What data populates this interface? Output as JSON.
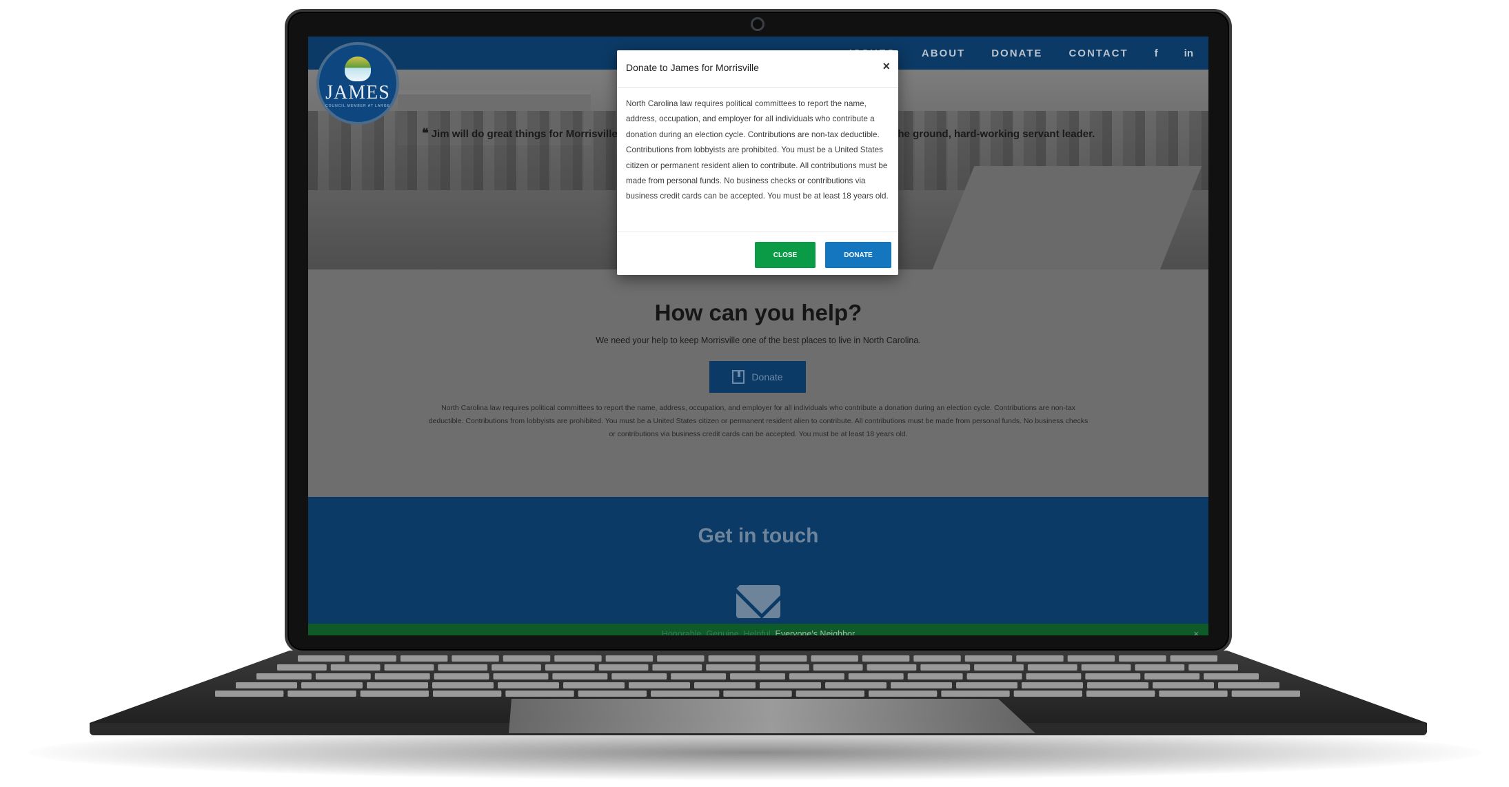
{
  "nav": {
    "links": [
      "ISSUES",
      "ABOUT",
      "DONATE",
      "CONTACT"
    ],
    "social": [
      "f",
      "in"
    ]
  },
  "logo": {
    "name": "JAMES",
    "sub": "COUNCIL MEMBER AT LARGE"
  },
  "hero": {
    "quote_start": "Jim will do great things for Morrisville. H",
    "quote_end": "on the ground, hard-working servant leader."
  },
  "help": {
    "title": "How can you help?",
    "subtitle": "We need your help to keep Morrisville one of the best places to live in North Carolina.",
    "donate_label": "Donate",
    "legal": "North Carolina law requires political committees to report the name, address, occupation, and employer for all individuals who contribute a donation during an election cycle. Contributions are non-tax deductible. Contributions from lobbyists are prohibited. You must be a United States citizen or permanent resident alien to contribute. All contributions must be made from personal funds. No business checks or contributions via business credit cards can be accepted. You must be at least 18 years old."
  },
  "touch": {
    "title": "Get in touch"
  },
  "footer": {
    "text": "Honorable. Genuine. Helpful.",
    "emphasis": "Everyone's Neighbor",
    "close": "×"
  },
  "modal": {
    "title": "Donate to James for Morrisville",
    "close_x": "×",
    "body": "North Carolina law requires political committees to report the name, address, occupation, and employer for all individuals who contribute a donation during an election cycle. Contributions are non-tax deductible. Contributions from lobbyists are prohibited. You must be a United States citizen or permanent resident alien to contribute. All contributions must be made from personal funds. No business checks or contributions via business credit cards can be accepted. You must be at least 18 years old.",
    "close_button": "CLOSE",
    "donate_button": "DONATE"
  },
  "colors": {
    "nav": "#0b3a66",
    "close_button": "#0b9a46",
    "donate_button": "#1476be",
    "footer_bar": "#0e5a29"
  },
  "icons": [
    "camera-icon",
    "facebook-icon",
    "linkedin-icon",
    "quote-icon",
    "donate-icon",
    "mail-icon",
    "close-icon"
  ]
}
